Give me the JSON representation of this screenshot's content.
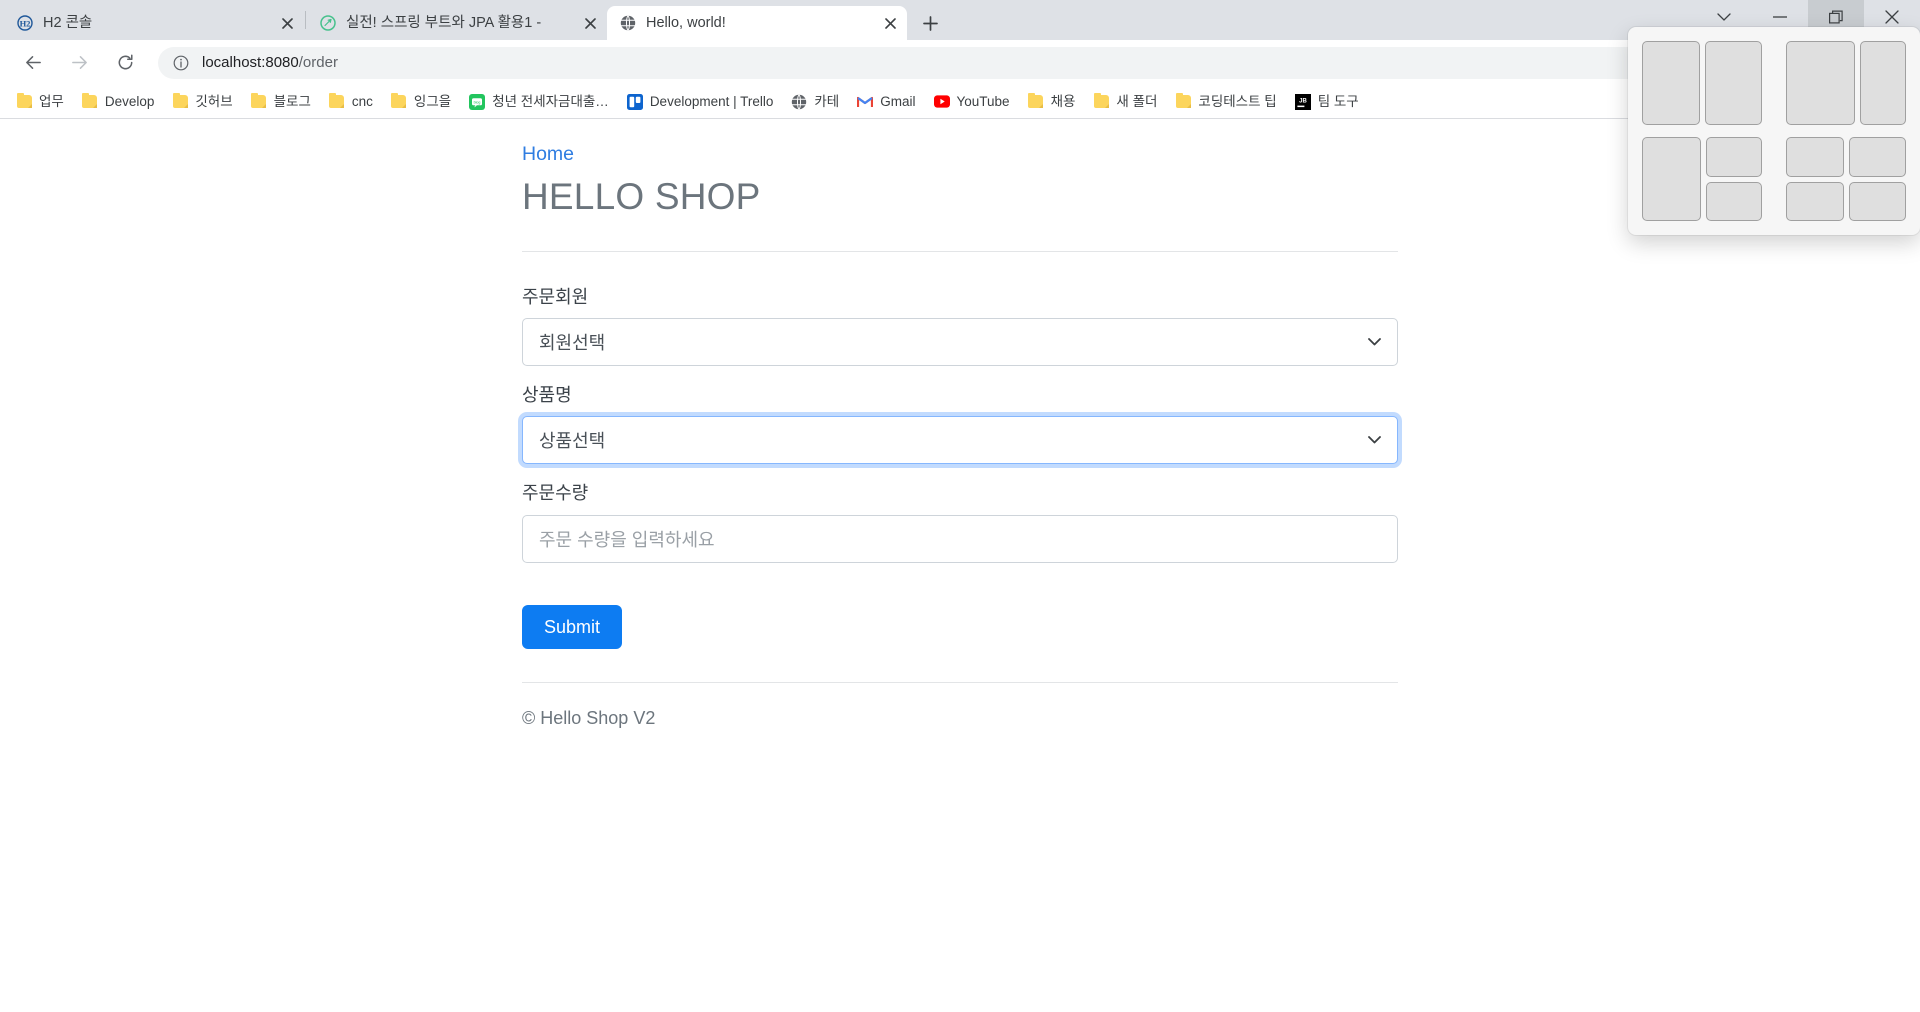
{
  "browser": {
    "tabs": [
      {
        "title": "H2 콘솔",
        "favicon": "h2-logo-icon",
        "active": false
      },
      {
        "title": "실전! 스프링 부트와 JPA 활용1 -",
        "favicon": "inflearn-icon",
        "active": false
      },
      {
        "title": "Hello, world!",
        "favicon": "globe-icon",
        "active": true
      }
    ],
    "new_tab_label": "+",
    "close_label": "✕",
    "window_controls": [
      {
        "name": "tab-search-chevron",
        "glyph": "⌄",
        "active": false
      },
      {
        "name": "minimize",
        "glyph": "—",
        "active": false
      },
      {
        "name": "maximize-restore",
        "glyph": "❐",
        "active": true
      },
      {
        "name": "close",
        "glyph": "✕",
        "active": false
      }
    ],
    "toolbar": {
      "back_label": "←",
      "forward_label": "→",
      "reload_label": "⟳",
      "site_info_label": "ⓘ",
      "share_label": "share-icon",
      "url_host": "localhost:8080",
      "url_path": "/order"
    },
    "bookmarks": [
      {
        "label": "업무",
        "icon": "folder-icon"
      },
      {
        "label": "Develop",
        "icon": "folder-icon"
      },
      {
        "label": "깃허브",
        "icon": "folder-icon"
      },
      {
        "label": "블로그",
        "icon": "folder-icon"
      },
      {
        "label": "cnc",
        "icon": "folder-icon"
      },
      {
        "label": "잉그을",
        "icon": "folder-icon"
      },
      {
        "label": "청년 전세자금대출…",
        "icon": "naver-blog-icon"
      },
      {
        "label": "Development | Trello",
        "icon": "trello-icon"
      },
      {
        "label": "카테",
        "icon": "globe-icon"
      },
      {
        "label": "Gmail",
        "icon": "gmail-icon"
      },
      {
        "label": "YouTube",
        "icon": "youtube-icon"
      },
      {
        "label": "채용",
        "icon": "folder-icon"
      },
      {
        "label": "새 폴더",
        "icon": "folder-icon"
      },
      {
        "label": "코딩테스트 팁",
        "icon": "folder-icon"
      },
      {
        "label": "팀 도구",
        "icon": "jetbrains-icon"
      }
    ]
  },
  "page": {
    "breadcrumb": "Home",
    "title": "HELLO SHOP",
    "form": {
      "fields": [
        {
          "label": "주문회원",
          "type": "select",
          "value": "회원선택",
          "focused": false,
          "is_placeholder": false
        },
        {
          "label": "상품명",
          "type": "select",
          "value": "상품선택",
          "focused": true,
          "is_placeholder": false
        },
        {
          "label": "주문수량",
          "type": "text",
          "value": "",
          "placeholder": "주문 수량을 입력하세요",
          "focused": false,
          "is_placeholder": true
        }
      ],
      "submit_label": "Submit"
    },
    "footer": "© Hello Shop V2"
  },
  "snap_layouts": {
    "options": [
      {
        "name": "two-equal-columns"
      },
      {
        "name": "wide-left-narrow-right"
      },
      {
        "name": "left-full-right-stacked"
      },
      {
        "name": "four-quadrants"
      }
    ]
  },
  "colors": {
    "accent_blue": "#0d7cf2",
    "link_blue": "#2f7de1",
    "title_gray": "#6c757d",
    "chrome_gray": "#dee1e6",
    "focus_ring": "#86b7fe"
  }
}
